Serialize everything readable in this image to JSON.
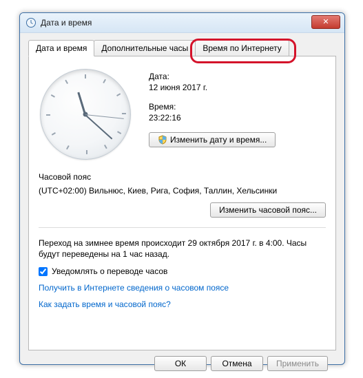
{
  "window": {
    "title": "Дата и время"
  },
  "tabs": {
    "t0": "Дата и время",
    "t1": "Дополнительные часы",
    "t2": "Время по Интернету"
  },
  "dateLabel": "Дата:",
  "dateValue": "12 июня 2017 г.",
  "timeLabel": "Время:",
  "timeValue": "23:22:16",
  "changeDateTimeBtn": "Изменить дату и время...",
  "tzHeader": "Часовой пояс",
  "tzValue": "(UTC+02:00) Вильнюс, Киев, Рига, София, Таллин, Хельсинки",
  "changeTzBtn": "Изменить часовой пояс...",
  "dstText": "Переход на зимнее время происходит 29 октября 2017 г. в 4:00. Часы будут переведены на 1 час назад.",
  "notifyLabel": "Уведомлять о переводе часов",
  "notifyChecked": true,
  "link1": "Получить в Интернете сведения о часовом поясе",
  "link2": "Как задать время и часовой пояс?",
  "buttons": {
    "ok": "ОК",
    "cancel": "Отмена",
    "apply": "Применить"
  },
  "colors": {
    "highlight": "#d4122a",
    "link": "#0066cc"
  }
}
